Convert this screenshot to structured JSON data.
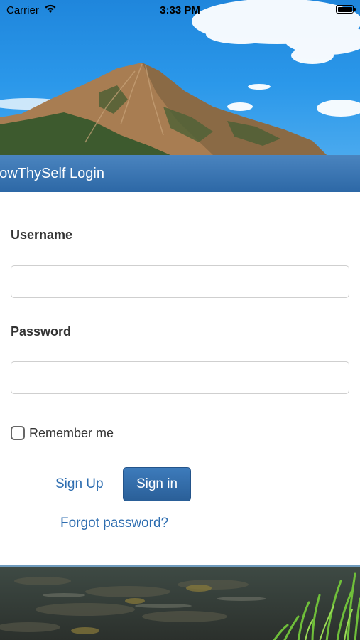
{
  "status_bar": {
    "carrier": "Carrier",
    "time": "3:33 PM",
    "wifi_icon": "wifi-icon",
    "battery_icon": "battery-icon"
  },
  "hero": {
    "image": "mountain-landscape-image"
  },
  "header": {
    "title": "nowThySelf Login"
  },
  "form": {
    "username_label": "Username",
    "username_value": "",
    "password_label": "Password",
    "password_value": "",
    "remember_label": "Remember me",
    "remember_checked": false,
    "signup_label": "Sign Up",
    "signin_label": "Sign in",
    "forgot_label": "Forgot password?"
  },
  "footer": {
    "image": "stream-grass-image"
  },
  "colors": {
    "header_bg": "#2d68a6",
    "link": "#2d6db0",
    "button_bg": "#2a5f98",
    "label_text": "#333333"
  }
}
